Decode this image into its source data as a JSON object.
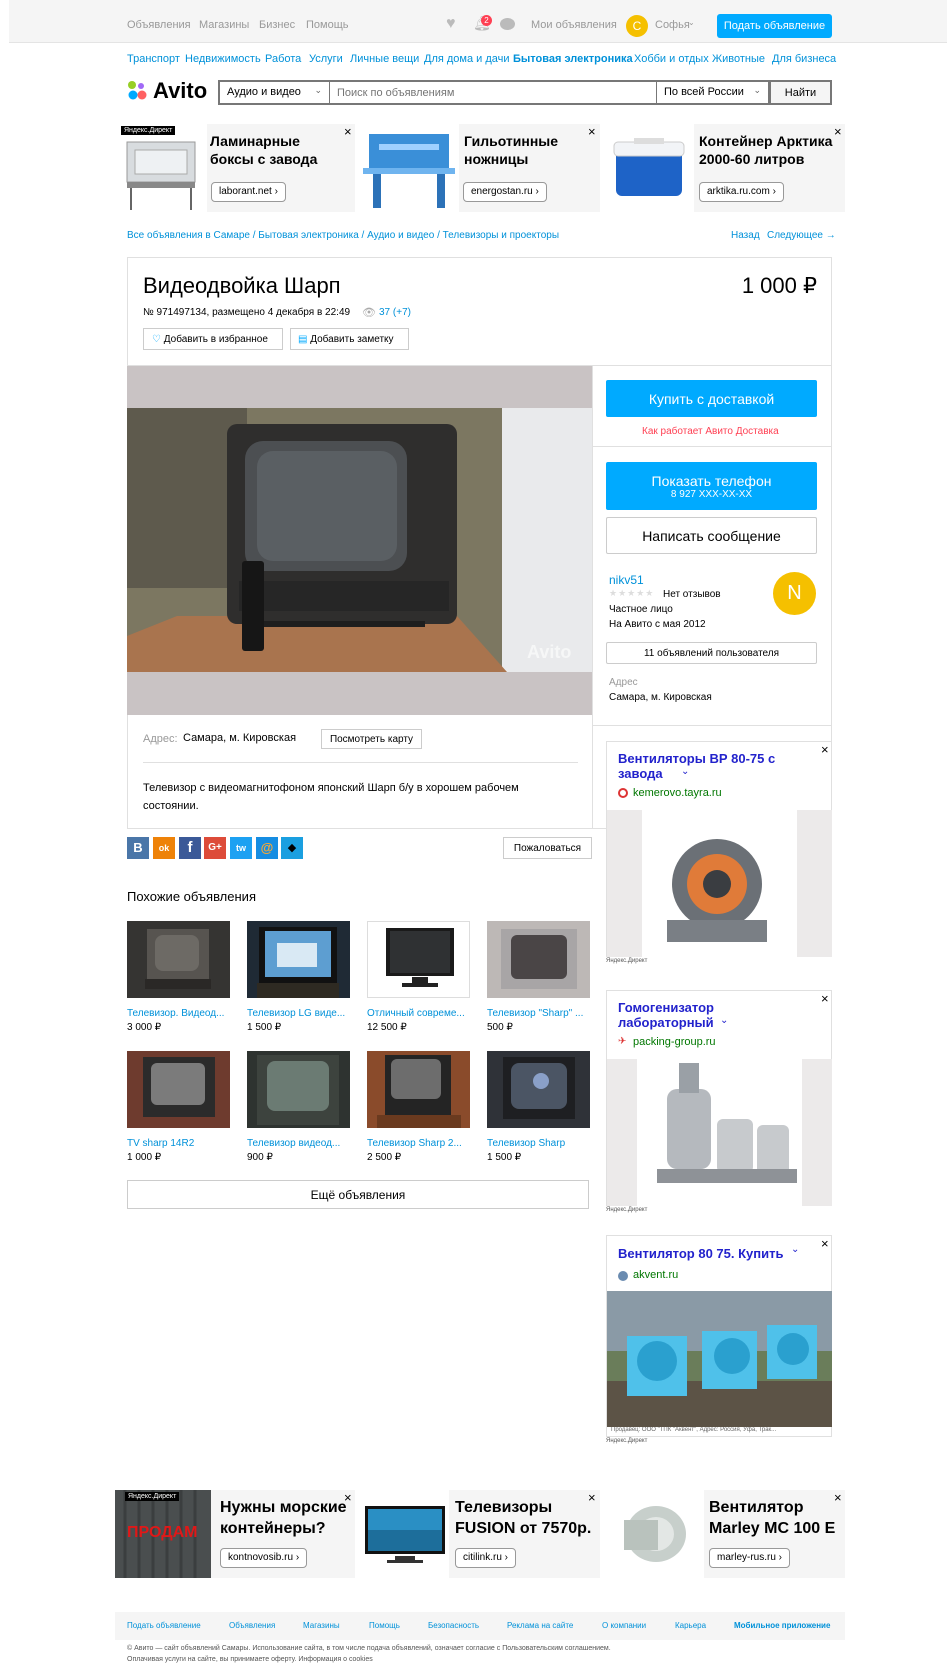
{
  "topbar": {
    "nav": [
      "Объявления",
      "Магазины",
      "Бизнес",
      "Помощь"
    ],
    "notif_count": "2",
    "my_ads": "Мои объявления",
    "avatar_letter": "С",
    "user": "Софья",
    "post_button": "Подать объявление"
  },
  "categories": [
    "Транспорт",
    "Недвижимость",
    "Работа",
    "Услуги",
    "Личные вещи",
    "Для дома и дачи",
    "Бытовая электроника",
    "Хобби и отдых",
    "Животные",
    "Для бизнеса"
  ],
  "search": {
    "logo": "Avito",
    "category": "Аудио и видео",
    "placeholder": "Поиск по объявлениям",
    "region": "По всей России",
    "button": "Найти"
  },
  "top_ads": [
    {
      "title": "Ламинарные боксы с завода",
      "domain": "laborant.net ›",
      "label": "Яндекс.Директ"
    },
    {
      "title": "Гильотинные ножницы",
      "domain": "energostan.ru ›"
    },
    {
      "title": "Контейнер Арктика 2000-60 литров",
      "domain": "arktika.ru.com ›"
    }
  ],
  "breadcrumb": "Все объявления в Самаре / Бытовая электроника / Аудио и видео / Телевизоры и проекторы",
  "nav_links": {
    "back": "Назад",
    "next": "Следующее →"
  },
  "listing": {
    "title": "Видеодвойка Шарп",
    "price": "1 000 ₽",
    "meta": "№ 971497134, размещено 4 декабря в 22:49",
    "views": "37 (+7)",
    "favorite": "Добавить в избранное",
    "note": "Добавить заметку",
    "watermark": "Avito",
    "address_label": "Адрес:",
    "address": "Самара, м. Кировская",
    "map_button": "Посмотреть карту",
    "description": "Телевизор с видеомагнитофоном японский Шарп б/у в хорошем рабочем состоянии."
  },
  "social": {
    "icons": [
      "В",
      "ok",
      "f",
      "G+",
      "tw",
      "@",
      "◆"
    ],
    "complain": "Пожаловаться"
  },
  "seller": {
    "buy": "Купить с доставкой",
    "delivery_link": "Как работает Авито Доставка",
    "phone_label": "Показать телефон",
    "phone": "8 927 XXX-XX-XX",
    "message": "Написать сообщение",
    "name": "nikv51",
    "reviews": "Нет отзывов",
    "type": "Частное лицо",
    "since": "На Авито с мая 2012",
    "avatar": "N",
    "ads_button": "11 объявлений пользователя",
    "addr_label": "Адрес",
    "addr": "Самара, м. Кировская"
  },
  "side_ads": [
    {
      "title": "Вентиляторы ВР 80-75 с завода",
      "domain": "kemerovo.tayra.ru",
      "label": "Яндекс.Директ"
    },
    {
      "title": "Гомогенизатор лабораторный",
      "domain": "packing-group.ru",
      "label": "Яндекс.Директ"
    },
    {
      "title": "Вентилятор 80 75. Купить",
      "domain": "akvent.ru",
      "caption": "Продавец: ООО \"ТПК \"Аквент\", Адрес: Россия, Уфа, Трак...",
      "label": "Яндекс.Директ"
    }
  ],
  "similar": {
    "heading": "Похожие объявления",
    "items": [
      {
        "title": "Телевизор. Видеод...",
        "price": "3 000 ₽"
      },
      {
        "title": "Телевизор LG виде...",
        "price": "1 500 ₽"
      },
      {
        "title": "Отличный совреме...",
        "price": "12 500 ₽"
      },
      {
        "title": "Телевизор \"Sharp\" ...",
        "price": "500 ₽"
      },
      {
        "title": "TV sharp 14R2",
        "price": "1 000 ₽"
      },
      {
        "title": "Телевизор видеод...",
        "price": "900 ₽"
      },
      {
        "title": "Телевизор Sharp 2...",
        "price": "2 500 ₽"
      },
      {
        "title": "Телевизор Sharp",
        "price": "1 500 ₽"
      }
    ],
    "more": "Ещё объявления"
  },
  "bottom_ads": [
    {
      "title": "Нужны морские контейнеры?",
      "domain": "kontnovosib.ru ›",
      "label": "Яндекс.Директ",
      "img_text": "ПРОДАМ"
    },
    {
      "title": "Телевизоры FUSION от 7570р.",
      "domain": "citilink.ru ›"
    },
    {
      "title": "Вентилятор Marley MC 100 E",
      "domain": "marley-rus.ru ›"
    }
  ],
  "footer": {
    "links": [
      "Подать объявление",
      "Объявления",
      "Магазины",
      "Помощь",
      "Безопасность",
      "Реклама на сайте",
      "О компании",
      "Карьера",
      "Мобильное приложение"
    ],
    "legal1": "© Авито — сайт объявлений Самары. Использование сайта, в том числе подача объявлений, означает согласие с Пользовательским соглашением.",
    "legal2": "Оплачивая услуги на сайте, вы принимаете оферту. Информация о cookies"
  },
  "colors": {
    "accent": "#00aaff",
    "link": "#0091d9",
    "ad_title": "#2222cc",
    "delivery": "#ff4053",
    "avatar": "#f5c000"
  }
}
